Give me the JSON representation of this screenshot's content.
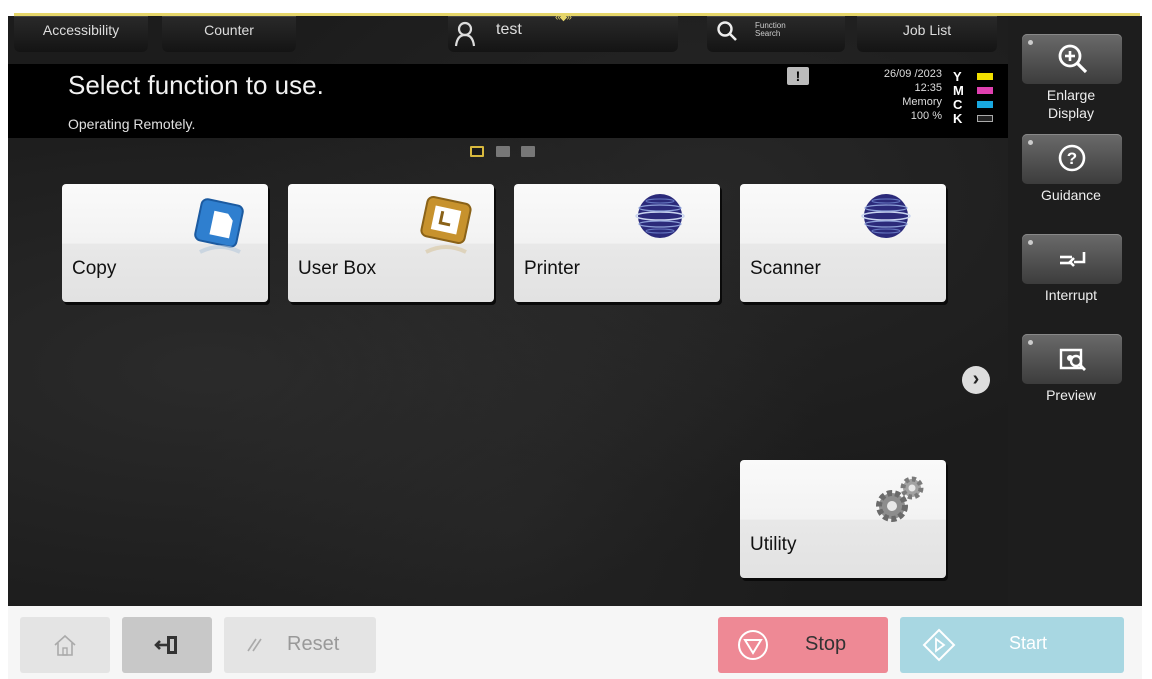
{
  "header": {
    "accessibility_tab": "Accessibility",
    "counter_tab": "Counter",
    "user_name": "test",
    "function_search_line1": "Function",
    "function_search_line2": "Search",
    "job_list_tab": "Job List",
    "handle_icon": "drag-handle-icon"
  },
  "message": {
    "title": "Select function to use.",
    "subtitle": "Operating Remotely."
  },
  "status": {
    "date": "26/09 /2023",
    "time": "12:35",
    "memory_label": "Memory",
    "memory_value": "100 %",
    "toner": [
      {
        "label": "Y",
        "color": "#f2e000"
      },
      {
        "label": "M",
        "color": "#e040b0"
      },
      {
        "label": "C",
        "color": "#19a8e0"
      },
      {
        "label": "K",
        "color": "#2a2a2a"
      }
    ]
  },
  "pager": {
    "current": 1,
    "total": 3
  },
  "functions": [
    {
      "label": "Copy",
      "icon": "copy-icon"
    },
    {
      "label": "User Box",
      "icon": "user-box-icon"
    },
    {
      "label": "Printer",
      "icon": "printer-globe-icon"
    },
    {
      "label": "Scanner",
      "icon": "scanner-globe-icon"
    },
    {
      "label": "Utility",
      "icon": "gears-icon"
    }
  ],
  "sidebar": {
    "enlarge_line1": "Enlarge",
    "enlarge_line2": "Display",
    "guidance": "Guidance",
    "interrupt": "Interrupt",
    "preview": "Preview"
  },
  "bottom": {
    "reset": "Reset",
    "stop": "Stop",
    "start": "Start"
  },
  "colors": {
    "accent": "#d8b93e",
    "stop": "#ee8995",
    "start": "#a8d7e2"
  }
}
